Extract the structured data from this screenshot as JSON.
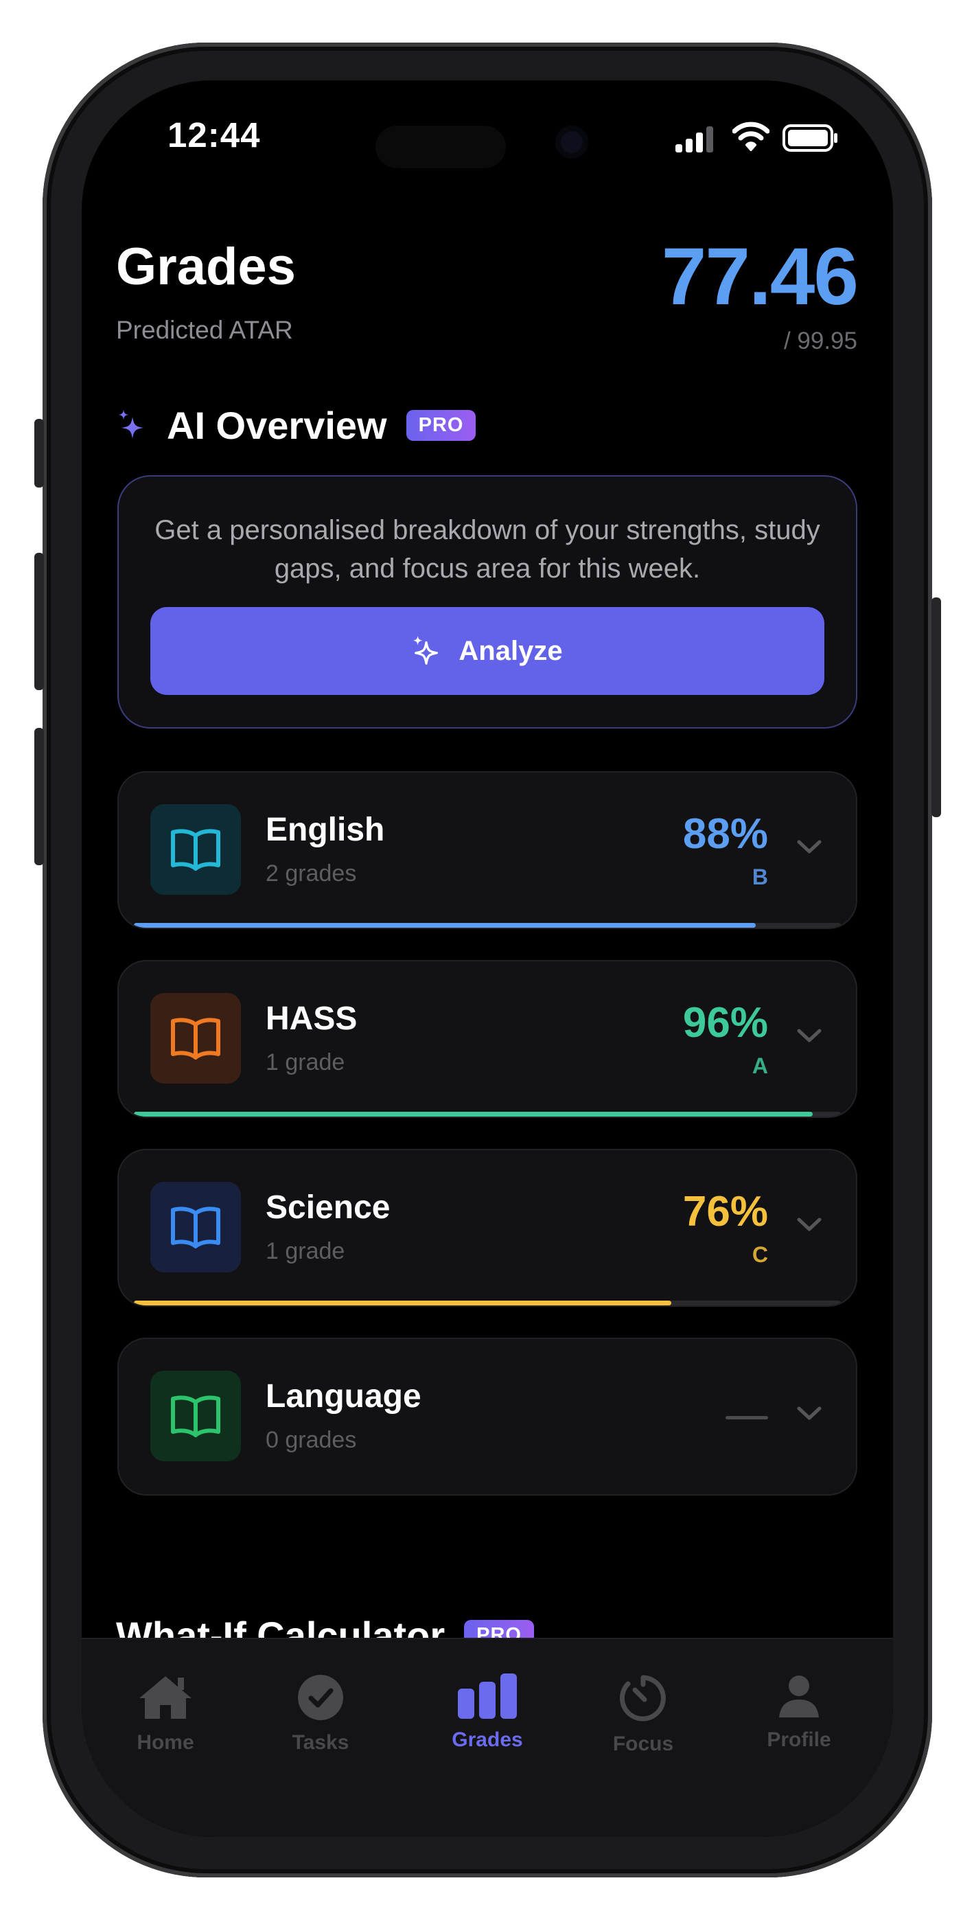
{
  "status_bar": {
    "time": "12:44"
  },
  "header": {
    "title": "Grades",
    "subtitle": "Predicted ATAR",
    "atar": "77.46",
    "atar_max": "/ 99.95"
  },
  "ai_overview": {
    "title": "AI Overview",
    "badge": "PRO",
    "description": "Get a personalised breakdown of your strengths, study gaps, and focus area for this week.",
    "button": "Analyze"
  },
  "subjects": [
    {
      "name": "English",
      "count": "2 grades",
      "percent": "88%",
      "grade": "B",
      "progress": 0.88,
      "color": "#5b9ef2",
      "icon_bg": "#0e2c35",
      "icon_color": "#22b8d6",
      "icon": "book-icon"
    },
    {
      "name": "HASS",
      "count": "1 grade",
      "percent": "96%",
      "grade": "A",
      "progress": 0.96,
      "color": "#3ec99a",
      "icon_bg": "#3a2014",
      "icon_color": "#f07a22",
      "icon": "book-icon"
    },
    {
      "name": "Science",
      "count": "1 grade",
      "percent": "76%",
      "grade": "C",
      "progress": 0.76,
      "color": "#f5c13c",
      "icon_bg": "#17213d",
      "icon_color": "#3b8bf5",
      "icon": "book-icon"
    },
    {
      "name": "Language",
      "count": "0 grades",
      "percent": "",
      "grade": "",
      "progress": 0,
      "color": "#4a4a4f",
      "icon_bg": "#10301e",
      "icon_color": "#2bc36b",
      "icon": "book-icon"
    }
  ],
  "what_if": {
    "title": "What-If Calculator",
    "badge": "PRO"
  },
  "tabs": [
    {
      "label": "Home",
      "icon": "home-icon",
      "active": false
    },
    {
      "label": "Tasks",
      "icon": "check-circle-icon",
      "active": false
    },
    {
      "label": "Grades",
      "icon": "bar-chart-icon",
      "active": true
    },
    {
      "label": "Focus",
      "icon": "timer-icon",
      "active": false
    },
    {
      "label": "Profile",
      "icon": "person-icon",
      "active": false
    }
  ],
  "colors": {
    "accent": "#6363ea",
    "atar": "#5b9ef2",
    "background": "#000000"
  }
}
